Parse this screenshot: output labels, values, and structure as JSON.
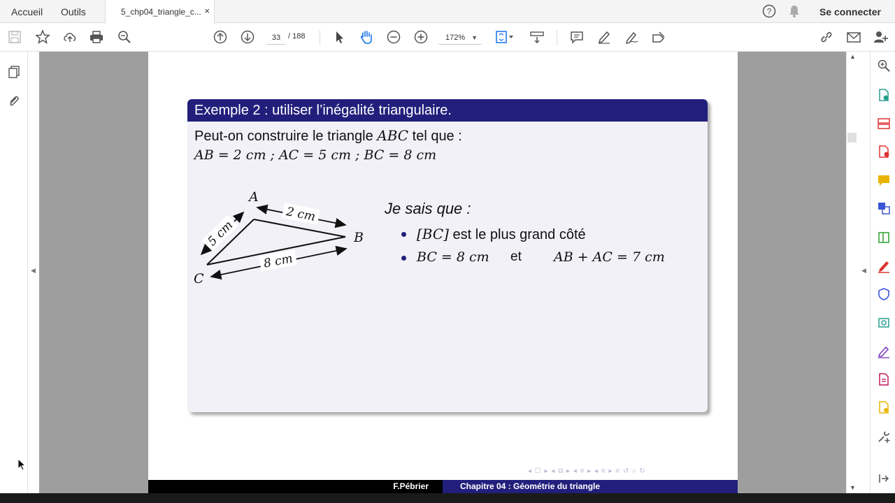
{
  "topnav": {
    "home": "Accueil",
    "tools": "Outils",
    "tab_title": "5_chp04_triangle_c...",
    "tab_close": "×",
    "signin": "Se connecter"
  },
  "toolbar": {
    "page_current": "33",
    "page_total": "/  188",
    "zoom": "172%"
  },
  "slide": {
    "block_title": "Exemple 2 : utiliser l’inégalité triangulaire.",
    "question_pre": "Peut-on construire le triangle ",
    "question_math": "ABC",
    "question_post": " tel que :",
    "lengths": "AB = 2  cm ;  AC = 5  cm ;  BC = 8  cm",
    "figure": {
      "A": "A",
      "B": "B",
      "C": "C",
      "ab_label": "2 cm",
      "ac_label": "5 cm",
      "bc_label": "8 cm"
    },
    "je_sais": "Je sais que :",
    "bullet1_math": "[BC]",
    "bullet1_text": " est le plus grand côté",
    "bullet2_a": "BC = 8  cm",
    "bullet2_et": "et",
    "bullet2_b": "AB + AC = 7  cm"
  },
  "footer": {
    "author": "F.Pébrier",
    "chapter": "Chapitre 04 :  Géométrie du triangle"
  },
  "beamer_nav": "◂ ☐ ▸  ◂ ⧉ ▸  ◂ ≡ ▸  ◂ ≡ ▸     ≡     ↺ ⌕ ↻"
}
